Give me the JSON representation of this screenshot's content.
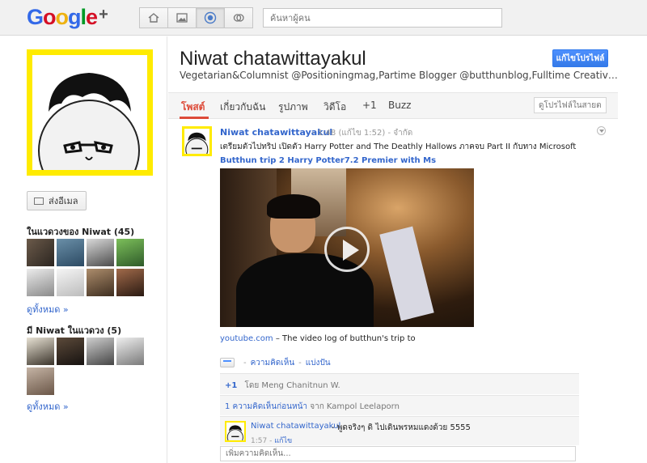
{
  "header": {
    "logo_text": "Google+",
    "nav": [
      {
        "icon": "home-icon"
      },
      {
        "icon": "photos-icon"
      },
      {
        "icon": "profile-icon",
        "active": true
      },
      {
        "icon": "circles-icon"
      }
    ],
    "search_placeholder": "ค้นหาผู้คน"
  },
  "sidebar": {
    "send_email_label": "ส่งอีเมล",
    "in_circles_title": "ในแวดวงของ Niwat (45)",
    "in_circles_see_all": "ดูทั้งหมด »",
    "has_in_circles_title": "มี Niwat ในแวดวง (5)",
    "has_in_circles_see_all": "ดูทั้งหมด »"
  },
  "profile": {
    "name": "Niwat chatawittayakul",
    "tagline": "Vegetarian&Columnist @Positioningmag,Partime Blogger @butthunblog,Fulltime Creative Director @...",
    "edit_button": "แก้ไขโปรไฟล์"
  },
  "tabs": [
    {
      "label": "โพสต์",
      "active": true
    },
    {
      "label": "เกี่ยวกับฉัน"
    },
    {
      "label": "รูปภาพ"
    },
    {
      "label": "วิดีโอ"
    },
    {
      "label": "+1"
    },
    {
      "label": "Buzz"
    }
  ],
  "tab_search_placeholder": "ดูโปรไฟล์ในสายตา",
  "post": {
    "author": "Niwat chatawittayakul",
    "time": "1:48",
    "edited": "(แก้ไข 1:52)",
    "visibility": "จำกัด",
    "text": "เตรียมตัวไปทริป เปิดตัว Harry Potter and The Deathly Hallows ภาคจบ Part II กับทาง Microsoft",
    "link_title": "Butthun trip 2 Harry Potter7.2 Premier with Ms",
    "video_source": "youtube.com",
    "video_desc": "– The video log of butthun's trip to",
    "action_comment": "ความคิดเห็น",
    "action_share": "แบ่งปัน",
    "plusone_label": "+1",
    "plusone_by": "โดย Meng Chanitnun W.",
    "prev_comments_link": "1 ความคิดเห็นก่อนหน้า",
    "prev_comments_from": "จาก Kampol Leelaporn",
    "comment": {
      "author": "Niwat chatawittayakul",
      "text": "- พูดจริงๆ ดิ ไปเดินพรหมแดงด้วย 5555",
      "time": "1:57",
      "edit": "แก้ไข"
    },
    "comment_placeholder": "เพิ่มความคิดเห็น..."
  },
  "colors": {
    "accent_red": "#dd4b39",
    "link_blue": "#3366cc",
    "avatar_frame": "#ffeb00",
    "button_blue": "#4d90fe"
  }
}
